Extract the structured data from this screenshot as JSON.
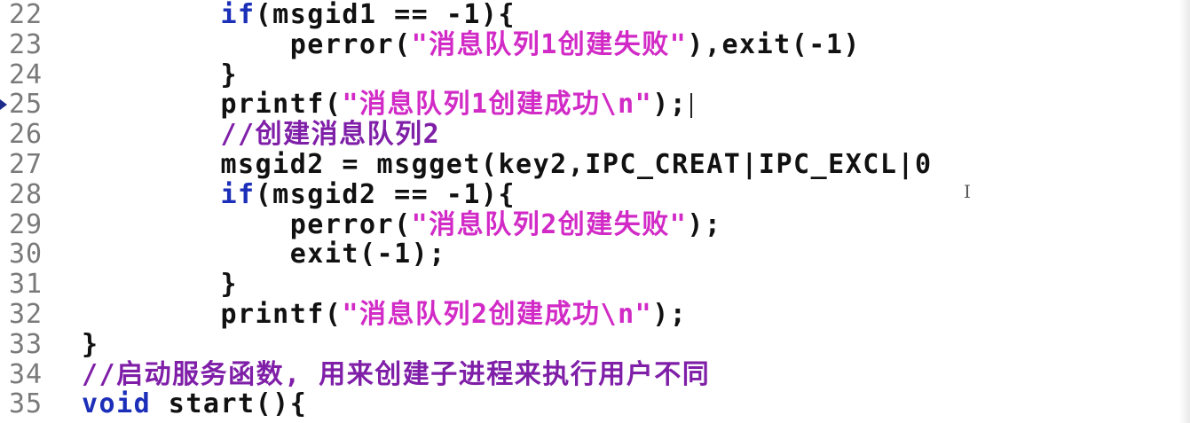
{
  "editor": {
    "lines": [
      {
        "num": "22",
        "parts": [
          {
            "t": "        "
          },
          {
            "t": "if",
            "c": "kw"
          },
          {
            "t": "(msgid1 == -1){"
          }
        ]
      },
      {
        "num": "23",
        "parts": [
          {
            "t": "            perror("
          },
          {
            "t": "\"消息队列1创建失败\"",
            "c": "str"
          },
          {
            "t": "),exit(-1)"
          }
        ]
      },
      {
        "num": "24",
        "parts": [
          {
            "t": "        }"
          }
        ]
      },
      {
        "num": "25",
        "parts": [
          {
            "t": "        printf("
          },
          {
            "t": "\"消息队列1创建成功\\n\"",
            "c": "str"
          },
          {
            "t": ");"
          }
        ],
        "cursor": true,
        "marker": true
      },
      {
        "num": "26",
        "parts": [
          {
            "t": "        "
          },
          {
            "t": "//创建消息队列2",
            "c": "cmt"
          }
        ]
      },
      {
        "num": "27",
        "parts": [
          {
            "t": "        msgid2 = msgget(key2,IPC_CREAT|IPC_EXCL|0"
          }
        ]
      },
      {
        "num": "28",
        "parts": [
          {
            "t": "        "
          },
          {
            "t": "if",
            "c": "kw"
          },
          {
            "t": "(msgid2 == -1){"
          }
        ]
      },
      {
        "num": "29",
        "parts": [
          {
            "t": "            perror("
          },
          {
            "t": "\"消息队列2创建失败\"",
            "c": "str"
          },
          {
            "t": ");"
          }
        ]
      },
      {
        "num": "30",
        "parts": [
          {
            "t": "            exit(-1);"
          }
        ]
      },
      {
        "num": "31",
        "parts": [
          {
            "t": "        }"
          }
        ]
      },
      {
        "num": "32",
        "parts": [
          {
            "t": "        printf("
          },
          {
            "t": "\"消息队列2创建成功\\n\"",
            "c": "str"
          },
          {
            "t": ");"
          }
        ]
      },
      {
        "num": "33",
        "parts": [
          {
            "t": "}"
          }
        ]
      },
      {
        "num": "34",
        "parts": [
          {
            "t": "//启动服务函数, 用来创建子进程来执行用户不同",
            "c": "cmt"
          }
        ]
      },
      {
        "num": "35",
        "parts": [
          {
            "t": "void",
            "c": "kw"
          },
          {
            "t": " start(){"
          }
        ]
      }
    ]
  },
  "colors": {
    "keyword": "#1c2fb8",
    "string": "#d12ac6",
    "comment": "#7f1fa8",
    "line_number": "#7a7a7a"
  },
  "icons": {
    "current_line_marker": "triangle-right-icon",
    "mouse_cursor": "ibeam-cursor-icon"
  }
}
